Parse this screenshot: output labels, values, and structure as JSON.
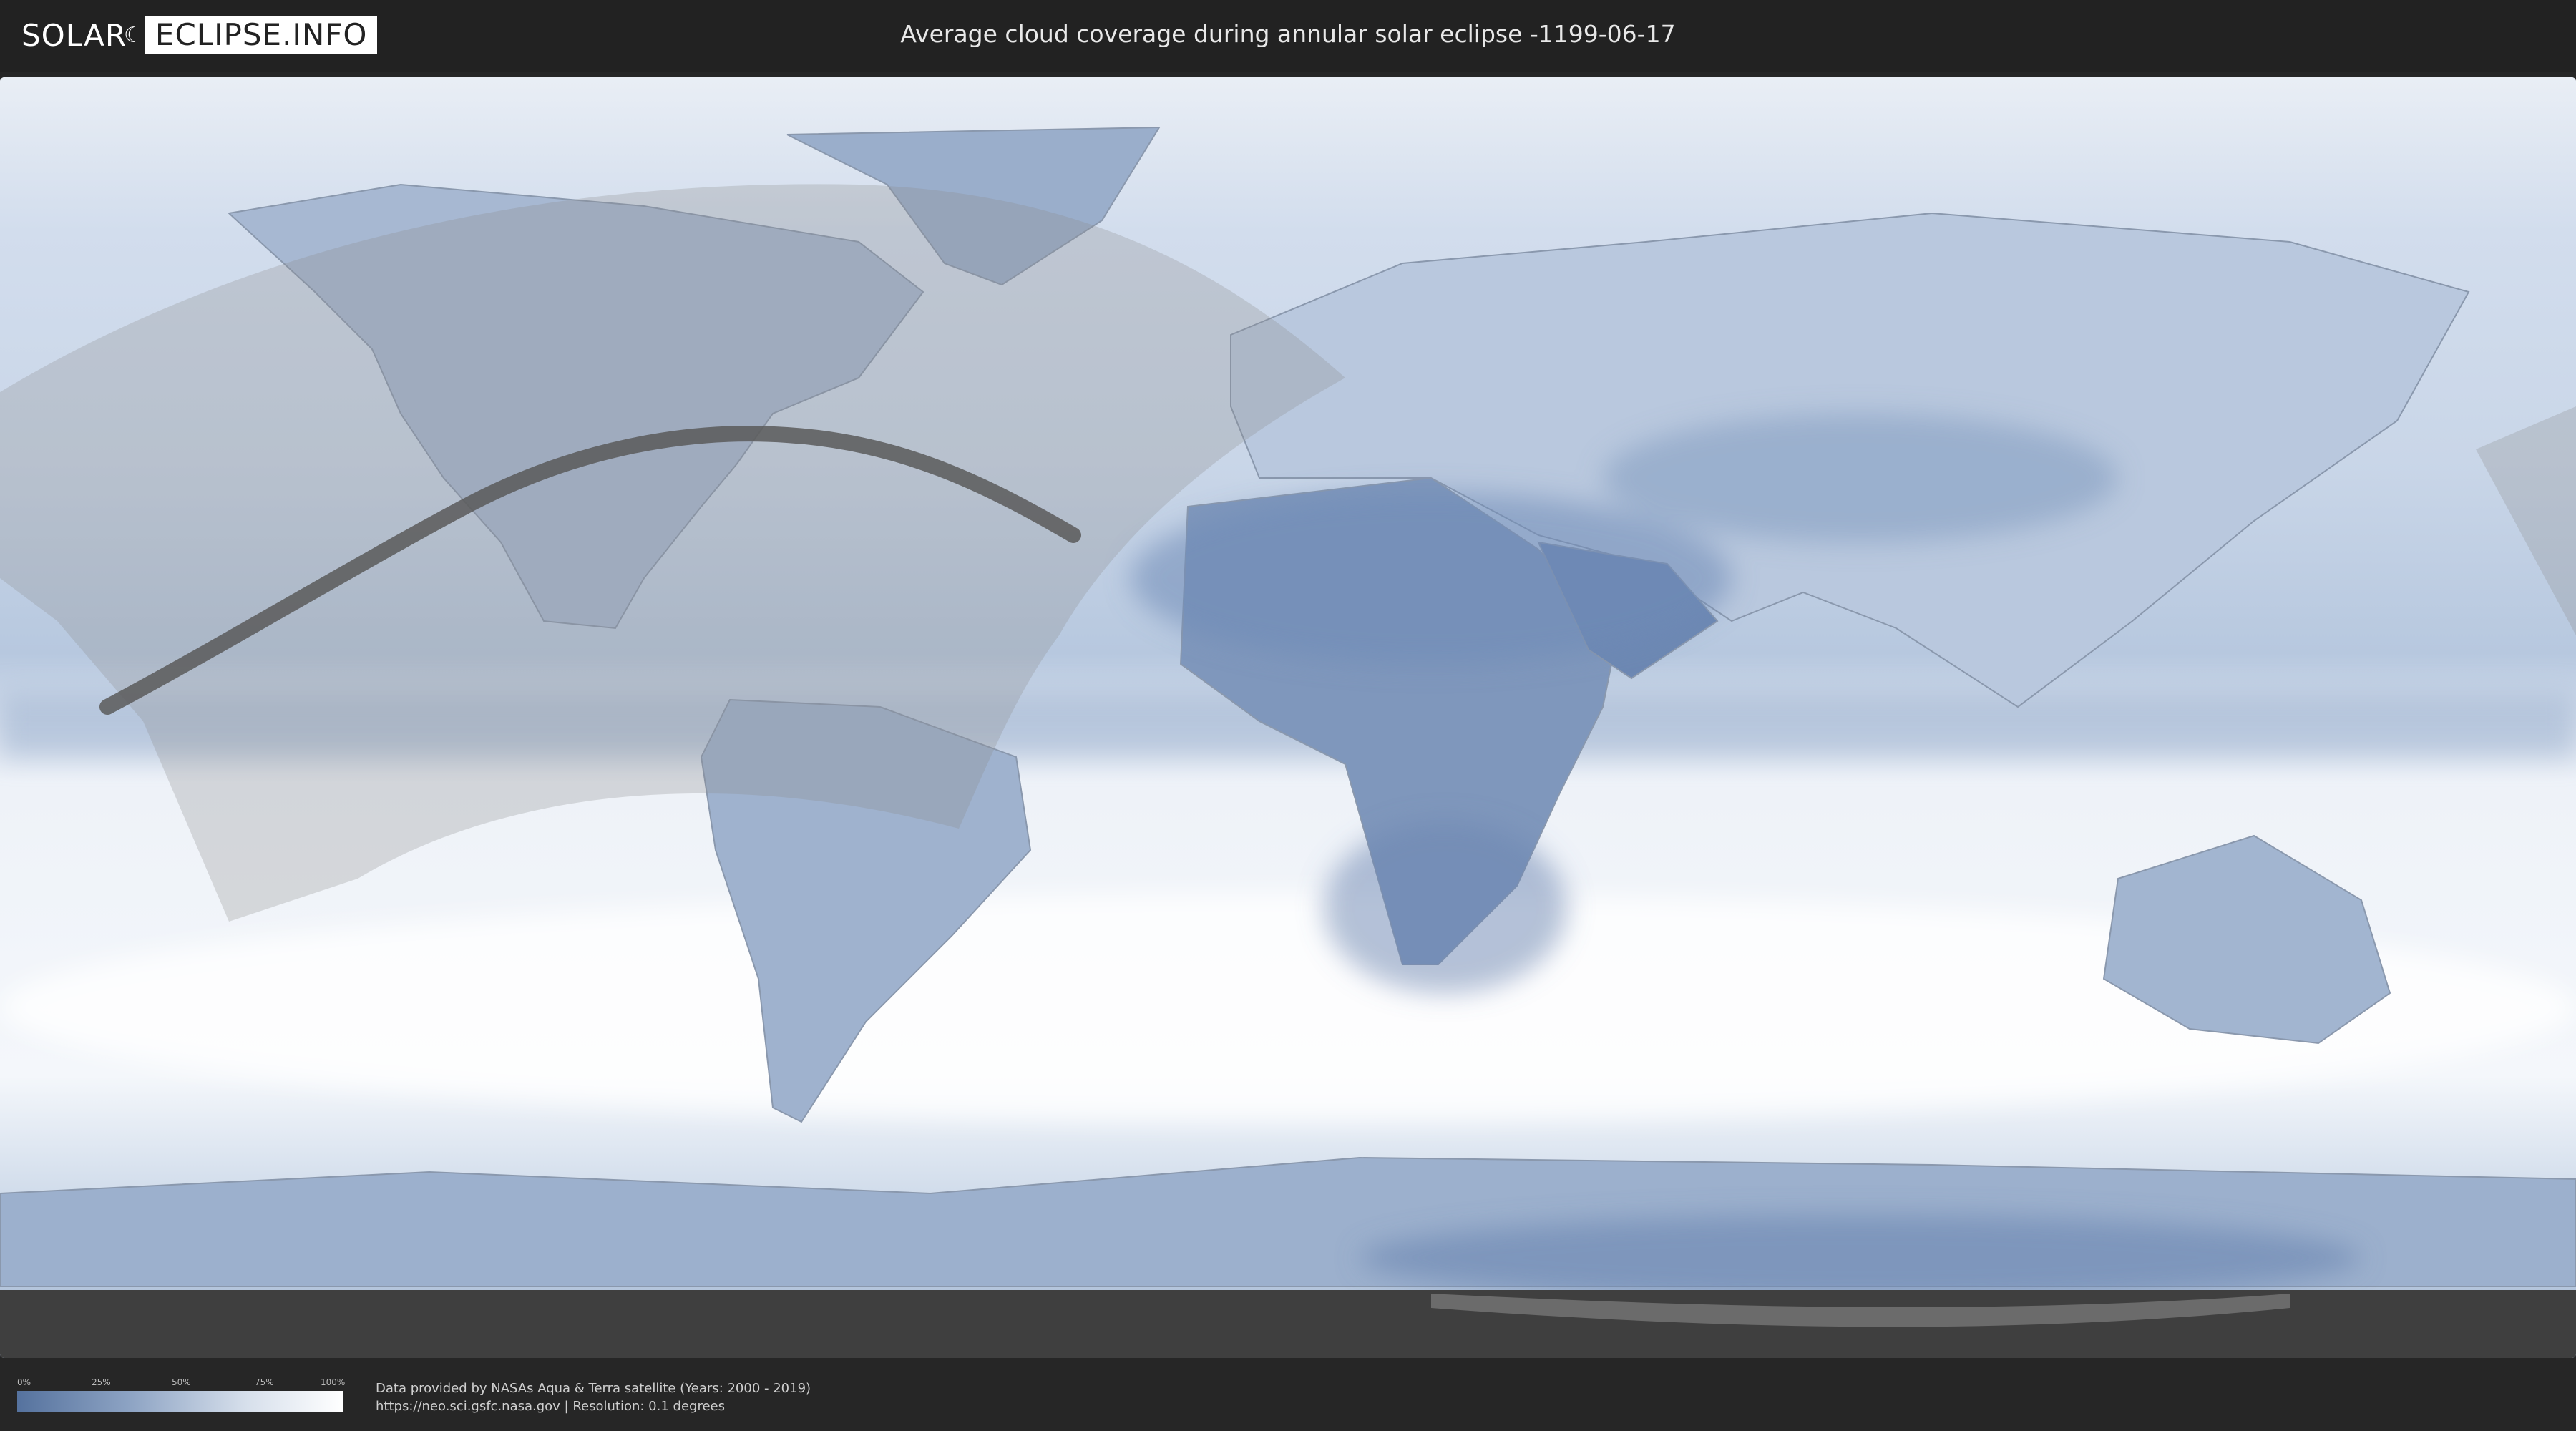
{
  "header": {
    "logo": {
      "left": "SOLAR",
      "right": "ECLIPSE.INFO"
    },
    "title": "Average cloud coverage during annular solar eclipse -1199-06-17"
  },
  "legend": {
    "ticks": [
      "0%",
      "25%",
      "50%",
      "75%",
      "100%"
    ],
    "colors": {
      "low": "#55729e",
      "mid": "#8ea4c4",
      "high": "#ffffff"
    }
  },
  "footer": {
    "line1": "Data provided by NASAs Aqua & Terra satellite (Years: 2000 - 2019)",
    "line2": "https://neo.sci.gsfc.nasa.gov | Resolution: 0.1 degrees"
  },
  "map": {
    "projection": "equirectangular world map",
    "colors": {
      "clear_sky": "#55729e",
      "cloudy": "#ffffff",
      "antarctic_strip": "#3f3f3f",
      "eclipse_path": "#5a5a5a"
    }
  }
}
